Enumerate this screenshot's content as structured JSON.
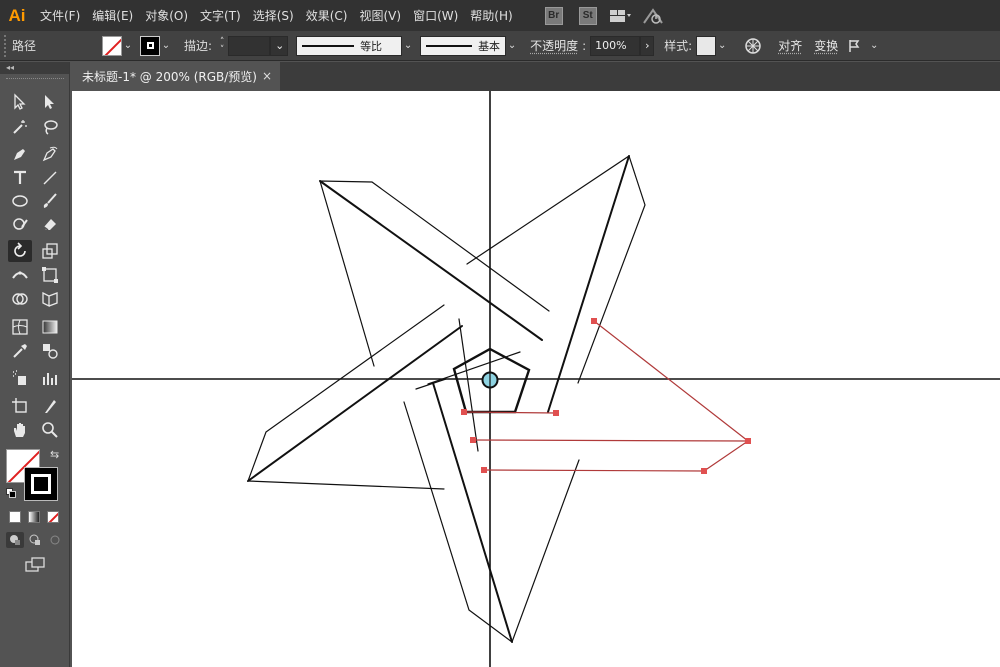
{
  "app": {
    "logo": "Ai"
  },
  "menu": {
    "items": [
      "文件(F)",
      "编辑(E)",
      "对象(O)",
      "文字(T)",
      "选择(S)",
      "效果(C)",
      "视图(V)",
      "窗口(W)",
      "帮助(H)"
    ],
    "bridge": "Br",
    "stock": "St"
  },
  "control": {
    "selection_type": "路径",
    "stroke_label": "描边",
    "stroke_profile": "等比",
    "brush": "基本",
    "opacity_label": "不透明度",
    "opacity_value": "100%",
    "style_label": "样式",
    "align": "对齐",
    "transform": "变换"
  },
  "document": {
    "tab_title": "未标题-1* @ 200% (RGB/预览)",
    "close": "×"
  },
  "toolbar": {
    "collapse": "◂◂"
  },
  "colors": {
    "chrome_dark": "#323232",
    "chrome": "#424242",
    "panel": "#535353",
    "accent_ai": "#ff9a00",
    "selection_path": "#b03a3a",
    "anchor": "#e05050"
  }
}
